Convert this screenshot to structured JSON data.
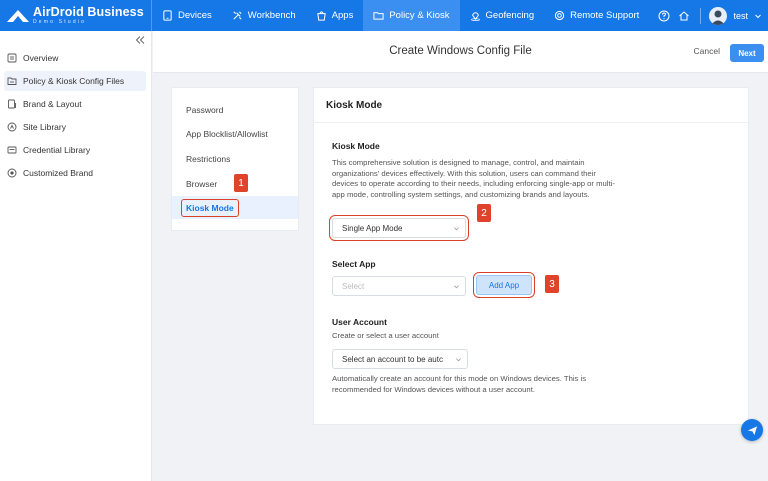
{
  "brand": {
    "name": "AirDroid Business",
    "sub": "Demo Studio"
  },
  "nav": [
    {
      "label": "Devices",
      "icon": "devices-icon"
    },
    {
      "label": "Workbench",
      "icon": "workbench-icon"
    },
    {
      "label": "Apps",
      "icon": "apps-icon"
    },
    {
      "label": "Policy & Kiosk",
      "icon": "policy-icon",
      "active": true
    },
    {
      "label": "Geofencing",
      "icon": "geofencing-icon"
    },
    {
      "label": "Remote Support",
      "icon": "remote-support-icon"
    }
  ],
  "user": {
    "name": "test"
  },
  "sidebar": {
    "items": [
      {
        "label": "Overview",
        "icon": "overview-icon"
      },
      {
        "label": "Policy & Kiosk Config Files",
        "icon": "config-files-icon",
        "active": true
      },
      {
        "label": "Brand & Layout",
        "icon": "brand-layout-icon"
      },
      {
        "label": "Site Library",
        "icon": "site-library-icon"
      },
      {
        "label": "Credential Library",
        "icon": "credential-library-icon"
      },
      {
        "label": "Customized Brand",
        "icon": "customized-brand-icon"
      }
    ]
  },
  "header": {
    "title": "Create Windows Config File",
    "cancel": "Cancel",
    "next": "Next"
  },
  "settings_nav": {
    "items": [
      {
        "label": "Password"
      },
      {
        "label": "App Blocklist/Allowlist"
      },
      {
        "label": "Restrictions"
      },
      {
        "label": "Browser"
      },
      {
        "label": "Kiosk Mode",
        "active": true
      }
    ]
  },
  "panel": {
    "title": "Kiosk Mode",
    "kiosk": {
      "title": "Kiosk Mode",
      "desc": "This comprehensive solution is designed to manage, control, and maintain organizations' devices effectively. With this solution, users can command their devices to operate according to their needs, including enforcing single-app or multi-app mode, controlling system settings, and customizing brands and layouts.",
      "mode_value": "Single App Mode"
    },
    "select_app": {
      "title": "Select App",
      "placeholder": "Select",
      "add_button": "Add App"
    },
    "user_account": {
      "title": "User Account",
      "subtitle": "Create or select a user account",
      "value": "Select an account to be autc",
      "note": "Automatically create an account for this mode on Windows devices. This is recommended for Windows devices without a user account."
    }
  },
  "annotations": {
    "badge1": "1",
    "badge2": "2",
    "badge3": "3"
  },
  "colors": {
    "primary": "#1677e6",
    "nav_active": "#3a8ff0",
    "highlight": "#d9412b"
  }
}
